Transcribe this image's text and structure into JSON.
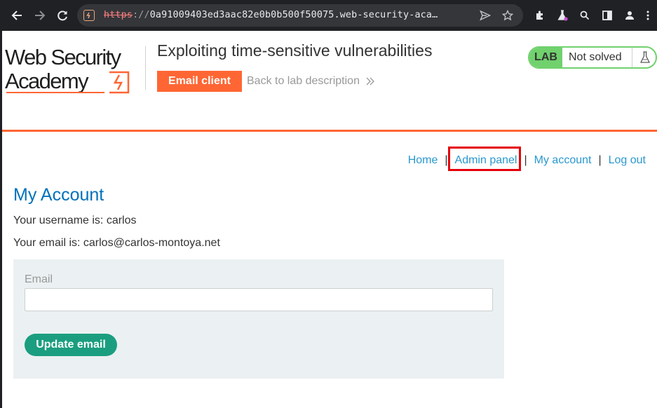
{
  "browser": {
    "url_scheme": "https",
    "url_separator": "://",
    "url_rest": "0a91009403ed3aac82e0b0b500f50075.web-security-aca…",
    "icons": [
      "back-arrow-icon",
      "forward-arrow-icon",
      "reload-icon",
      "site-icon",
      "send-icon",
      "bookmark-star-icon",
      "extensions-icon",
      "lab-flask-icon",
      "search-icon",
      "side-panel-icon",
      "profile-icon",
      "menu-icon"
    ]
  },
  "header": {
    "logo_line1": "Web Security",
    "logo_line2": "Academy",
    "lab_title": "Exploiting time-sensitive vulnerabilities",
    "email_client_label": "Email client",
    "back_link_label": "Back to lab description",
    "lab_tag": "LAB",
    "lab_state": "Not solved"
  },
  "nav": {
    "items": [
      {
        "label": "Home"
      },
      {
        "label": "Admin panel"
      },
      {
        "label": "My account"
      },
      {
        "label": "Log out"
      }
    ],
    "separator": "|"
  },
  "account": {
    "heading": "My Account",
    "username_line": "Your username is: carlos",
    "email_line": "Your email is: carlos@carlos-montoya.net",
    "form": {
      "email_label": "Email",
      "email_value": "",
      "submit_label": "Update email"
    }
  },
  "colors": {
    "accent": "#ff6633",
    "link": "#2a98ce",
    "heading": "#0071bc",
    "lab_green": "#70d16d",
    "button_green": "#1a9e7f",
    "highlight": "#e5000a"
  }
}
